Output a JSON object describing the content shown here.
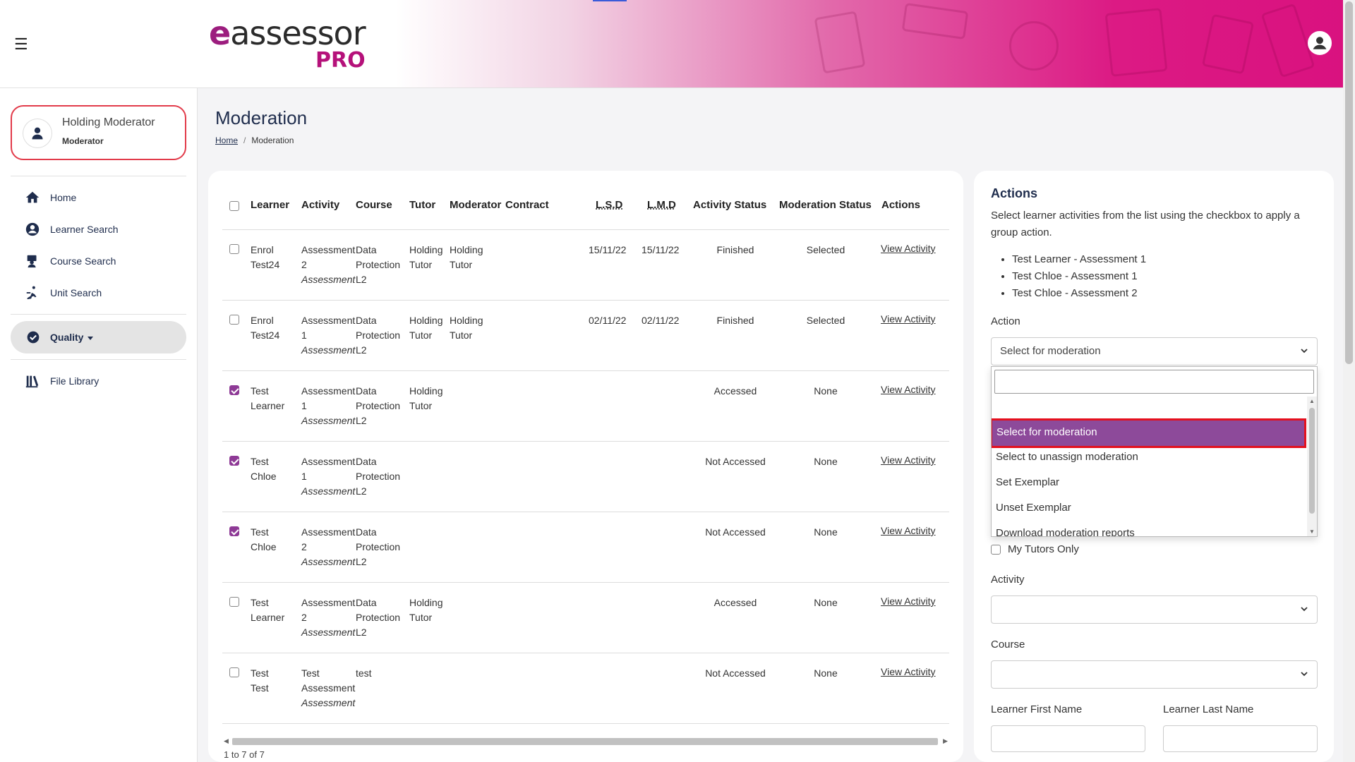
{
  "app": {
    "logo_main": "assessor",
    "logo_e": "e",
    "logo_pro": "PRO"
  },
  "sidebar": {
    "profile": {
      "name": "Holding Moderator",
      "role": "Moderator"
    },
    "items": [
      {
        "label": "Home",
        "icon": "home-icon"
      },
      {
        "label": "Learner Search",
        "icon": "user-circle-icon"
      },
      {
        "label": "Course Search",
        "icon": "course-icon"
      },
      {
        "label": "Unit Search",
        "icon": "unit-icon"
      }
    ],
    "quality": {
      "label": "Quality",
      "icon": "check-circle-icon"
    },
    "file_library": {
      "label": "File Library",
      "icon": "library-icon"
    }
  },
  "page": {
    "title": "Moderation",
    "breadcrumb_home": "Home",
    "breadcrumb_sep": "/",
    "breadcrumb_current": "Moderation"
  },
  "table": {
    "columns": [
      "Learner",
      "Activity",
      "Course",
      "Tutor",
      "Moderator",
      "Contract",
      "L.S.D",
      "L.M.D",
      "Activity Status",
      "Moderation Status",
      "Actions"
    ],
    "rows": [
      {
        "checked": false,
        "learner1": "Enrol",
        "learner2": "Test24",
        "activity1": "Assessment",
        "activity2": "2",
        "activity_type": "Assessment",
        "course1": "Data",
        "course2": "Protection",
        "course3": "L2",
        "tutor1": "Holding",
        "tutor2": "Tutor",
        "mod1": "Holding",
        "mod2": "Tutor",
        "lsd": "15/11/22",
        "lmd": "15/11/22",
        "activity_status": "Finished",
        "moderation_status": "Selected",
        "action": "View Activity"
      },
      {
        "checked": false,
        "learner1": "Enrol",
        "learner2": "Test24",
        "activity1": "Assessment",
        "activity2": "1",
        "activity_type": "Assessment",
        "course1": "Data",
        "course2": "Protection",
        "course3": "L2",
        "tutor1": "Holding",
        "tutor2": "Tutor",
        "mod1": "Holding",
        "mod2": "Tutor",
        "lsd": "02/11/22",
        "lmd": "02/11/22",
        "activity_status": "Finished",
        "moderation_status": "Selected",
        "action": "View Activity"
      },
      {
        "checked": true,
        "learner1": "Test",
        "learner2": "Learner",
        "activity1": "Assessment",
        "activity2": "1",
        "activity_type": "Assessment",
        "course1": "Data",
        "course2": "Protection",
        "course3": "L2",
        "tutor1": "Holding",
        "tutor2": "Tutor",
        "mod1": "",
        "mod2": "",
        "lsd": "",
        "lmd": "",
        "activity_status": "Accessed",
        "moderation_status": "None",
        "action": "View Activity"
      },
      {
        "checked": true,
        "learner1": "Test",
        "learner2": "Chloe",
        "activity1": "Assessment",
        "activity2": "1",
        "activity_type": "Assessment",
        "course1": "Data",
        "course2": "Protection",
        "course3": "L2",
        "tutor1": "",
        "tutor2": "",
        "mod1": "",
        "mod2": "",
        "lsd": "",
        "lmd": "",
        "activity_status": "Not Accessed",
        "moderation_status": "None",
        "action": "View Activity"
      },
      {
        "checked": true,
        "learner1": "Test",
        "learner2": "Chloe",
        "activity1": "Assessment",
        "activity2": "2",
        "activity_type": "Assessment",
        "course1": "Data",
        "course2": "Protection",
        "course3": "L2",
        "tutor1": "",
        "tutor2": "",
        "mod1": "",
        "mod2": "",
        "lsd": "",
        "lmd": "",
        "activity_status": "Not Accessed",
        "moderation_status": "None",
        "action": "View Activity"
      },
      {
        "checked": false,
        "learner1": "Test",
        "learner2": "Learner",
        "activity1": "Assessment",
        "activity2": "2",
        "activity_type": "Assessment",
        "course1": "Data",
        "course2": "Protection",
        "course3": "L2",
        "tutor1": "Holding",
        "tutor2": "Tutor",
        "mod1": "",
        "mod2": "",
        "lsd": "",
        "lmd": "",
        "activity_status": "Accessed",
        "moderation_status": "None",
        "action": "View Activity"
      },
      {
        "checked": false,
        "learner1": "Test",
        "learner2": "Test",
        "activity1": "Test",
        "activity2": "Assessment",
        "activity_type": "Assessment",
        "course1": "test",
        "course2": "",
        "course3": "",
        "tutor1": "",
        "tutor2": "",
        "mod1": "",
        "mod2": "",
        "lsd": "",
        "lmd": "",
        "activity_status": "Not Accessed",
        "moderation_status": "None",
        "action": "View Activity"
      }
    ],
    "count_text": "1 to 7 of 7"
  },
  "actions": {
    "title": "Actions",
    "description": "Select learner activities from the list using the checkbox to apply a group action.",
    "selected": [
      "Test Learner - Assessment 1",
      "Test Chloe - Assessment 1",
      "Test Chloe - Assessment 2"
    ],
    "action_label": "Action",
    "action_value": "Select for moderation",
    "search_value": "",
    "options": [
      "Select for moderation",
      "Select to unassign moderation",
      "Set Exemplar",
      "Unset Exemplar",
      "Download moderation reports"
    ],
    "my_tutors_label": "My Tutors Only",
    "activity_label": "Activity",
    "course_label": "Course",
    "first_name_label": "Learner First Name",
    "last_name_label": "Learner Last Name"
  },
  "colors": {
    "accent": "#8e3a96",
    "brand_pink": "#d9117f",
    "highlight_border": "#e4101e"
  }
}
